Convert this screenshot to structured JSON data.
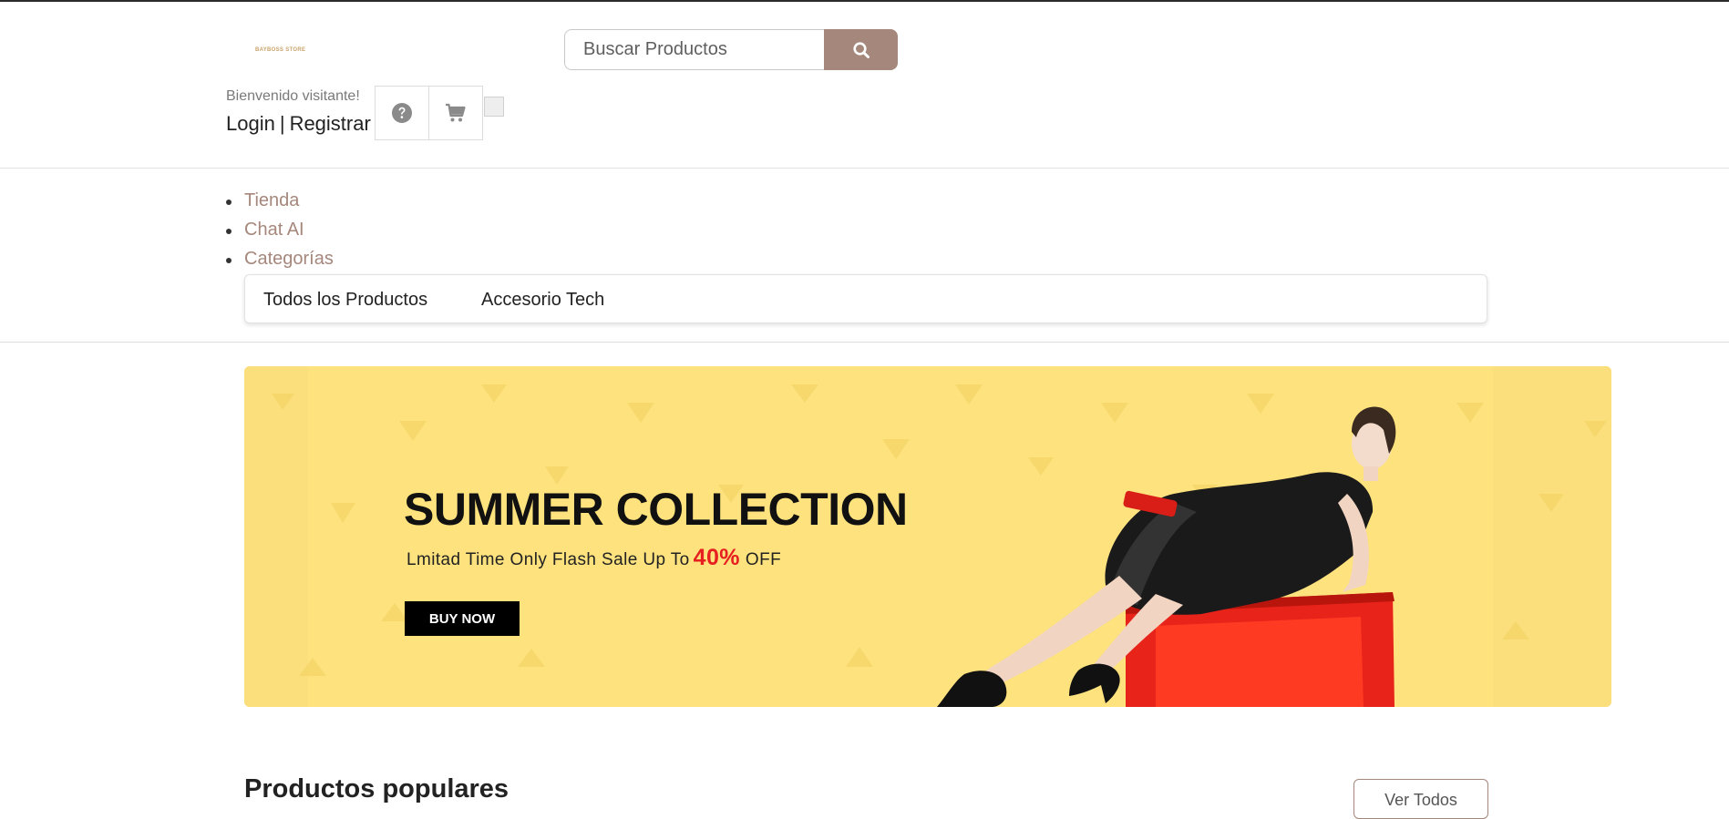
{
  "header": {
    "logo_text": "BAYBOSS STORE",
    "search": {
      "placeholder": "Buscar Productos",
      "icon": "search-icon"
    },
    "welcome": "Bienvenido visitante!",
    "login": "Login",
    "separator": "|",
    "register": "Registrar",
    "icons": [
      "question-circle-icon",
      "cart-icon"
    ]
  },
  "nav": {
    "items": [
      {
        "label": "Tienda"
      },
      {
        "label": "Chat AI"
      },
      {
        "label": "Categorías"
      }
    ],
    "categories": [
      {
        "label": "Todos los Productos"
      },
      {
        "label": "Accesorio Tech"
      }
    ]
  },
  "banner": {
    "title": "SUMMER COLLECTION",
    "subtitle": "Lmitad Time Only Flash Sale Up To",
    "discount": "40%",
    "off": "OFF",
    "cta": "BUY NOW",
    "colors": {
      "background": "#fbdf7c",
      "accent": "#e62020",
      "box": "#e8231a"
    }
  },
  "popular": {
    "title": "Productos populares",
    "view_all": "Ver Todos"
  },
  "colors": {
    "brand": "#a5877c",
    "text": "#222222"
  }
}
